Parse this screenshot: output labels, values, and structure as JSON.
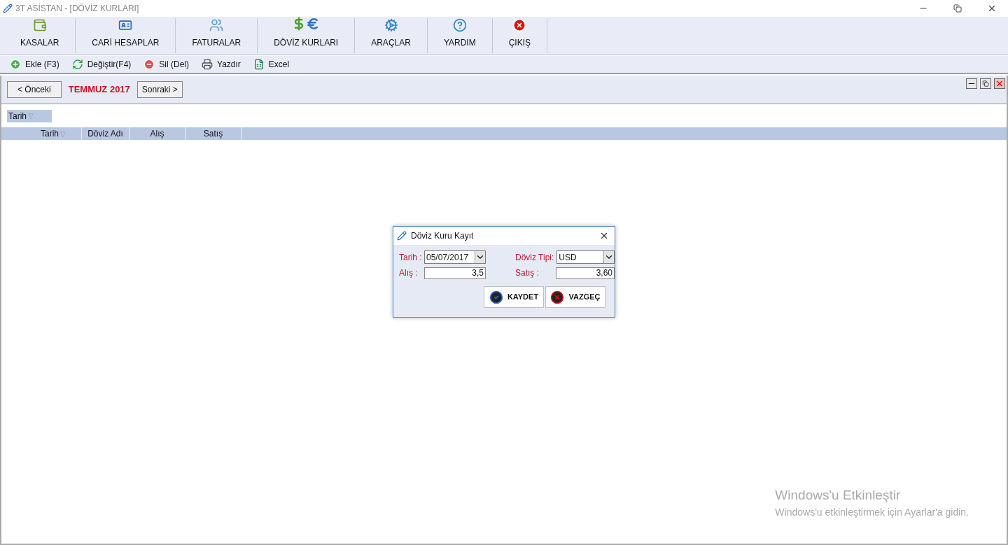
{
  "window": {
    "title": "3T ASİSTAN - [DÖVİZ KURLARI]"
  },
  "main_toolbar": [
    {
      "label": "KASALAR",
      "kind": "cash"
    },
    {
      "label": "CARİ HESAPLAR",
      "kind": "accounts"
    },
    {
      "label": "FATURALAR",
      "kind": "invoices"
    },
    {
      "label": "DÖVİZ KURLARI",
      "kind": "currency"
    },
    {
      "label": "ARAÇLAR",
      "kind": "tools"
    },
    {
      "label": "YARDIM",
      "kind": "help"
    },
    {
      "label": "ÇIKIŞ",
      "kind": "exit"
    }
  ],
  "action_toolbar": [
    {
      "label": "Ekle (F3)",
      "kind": "add"
    },
    {
      "label": "Değiştir(F4)",
      "kind": "edit"
    },
    {
      "label": "Sil (Del)",
      "kind": "delete"
    },
    {
      "label": "Yazdır",
      "kind": "print"
    },
    {
      "label": "Excel",
      "kind": "excel"
    }
  ],
  "period": {
    "previous": "< Önceki",
    "month": "TEMMUZ 2017",
    "next": "Sonraki >"
  },
  "group_panel": {
    "chip": "Tarih",
    "chip_arrow": "▽"
  },
  "table": {
    "columns": [
      {
        "label": "Tarih",
        "sorted": true
      },
      {
        "label": "Döviz Adı",
        "sorted": false
      },
      {
        "label": "Alış",
        "sorted": false
      },
      {
        "label": "Satış",
        "sorted": false
      }
    ],
    "sort_arrow": "▽"
  },
  "dialog": {
    "title": "Döviz Kuru Kayıt",
    "fields": [
      {
        "label": "Tarih :",
        "value": "05/07/2017",
        "kind": "dropdown"
      },
      {
        "label": "Döviz Tipi:",
        "value": "USD",
        "kind": "dropdown"
      },
      {
        "label": "Alış :",
        "value": "3,5",
        "kind": "text"
      },
      {
        "label": "Satış :",
        "value": "3,60",
        "kind": "text"
      }
    ],
    "buttons": [
      {
        "label": "KAYDET",
        "kind": "save"
      },
      {
        "label": "VAZGEÇ",
        "kind": "cancel"
      }
    ]
  },
  "watermark_notice": {
    "title": "Windows'u Etkinleştir",
    "text": "Windows'u etkinleştirmek için Ayarlar'a gidin."
  }
}
